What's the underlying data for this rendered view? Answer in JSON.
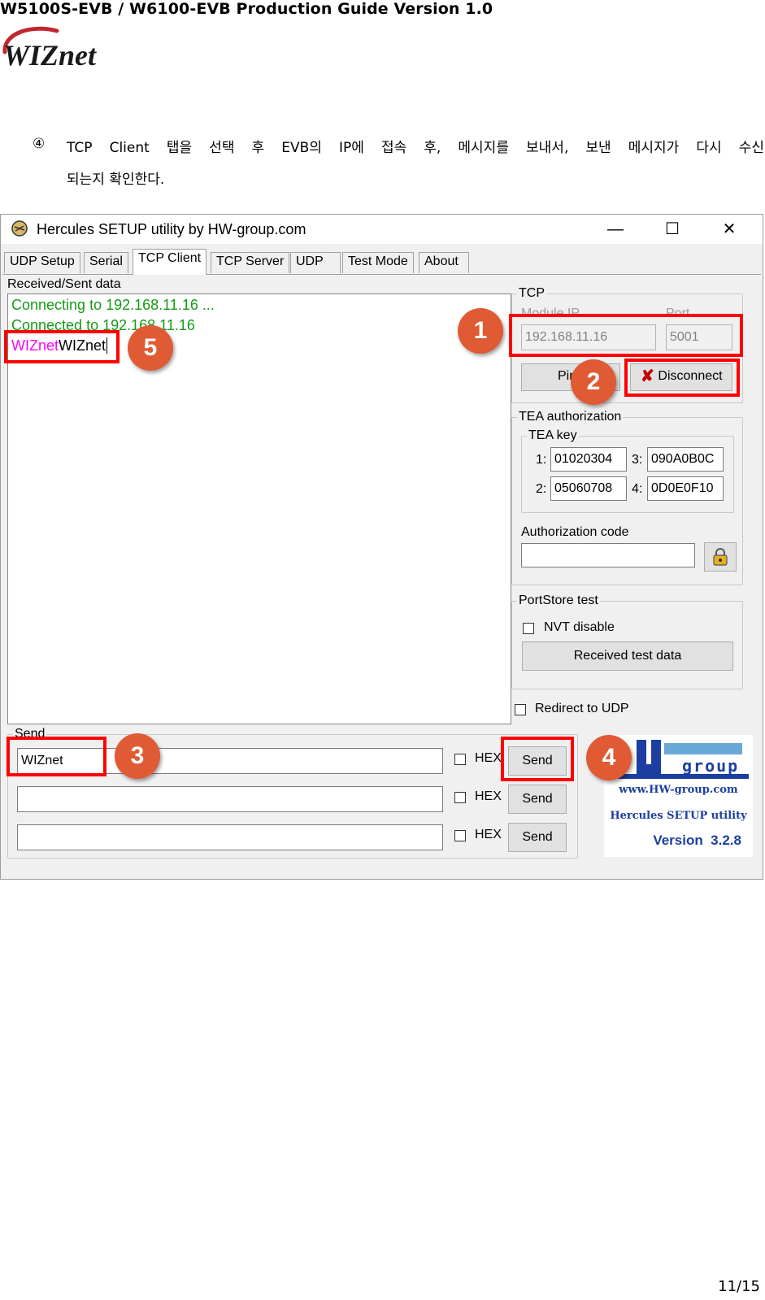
{
  "document": {
    "header": "W5100S-EVB / W6100-EVB Production Guide Version 1.0",
    "logo_text": "WIZnet",
    "step_number": "④",
    "step_text_line1": "TCP Client 탭을 선택 후 EVB의 IP에 접속 후, 메시지를 보내서, 보낸 메시지가 다시 수신",
    "step_text_line2": "되는지 확인한다.",
    "page_number": "11/15"
  },
  "window": {
    "title": "Hercules SETUP utility by HW-group.com",
    "controls": {
      "minimize": "—",
      "maximize": "☐",
      "close": "✕"
    },
    "tabs": [
      "UDP Setup",
      "Serial",
      "TCP Client",
      "TCP Server",
      "UDP",
      "Test Mode",
      "About"
    ],
    "active_tab": "TCP Client",
    "received": {
      "label": "Received/Sent data",
      "lines": [
        "Connecting to 192.168.11.16 ...",
        "Connected to 192.168.11.16"
      ],
      "echo_sent": "WIZnet",
      "echo_received": "WIZnet"
    },
    "tcp": {
      "legend": "TCP",
      "module_ip_label": "Module IP",
      "module_ip": "192.168.11.16",
      "port_label": "Port",
      "port": "5001",
      "ping_label": "Ping",
      "disconnect_label": "Disconnect"
    },
    "tea": {
      "legend": "TEA authorization",
      "key_legend": "TEA key",
      "keys": [
        {
          "label": "1:",
          "value": "01020304"
        },
        {
          "label": "3:",
          "value": "090A0B0C"
        },
        {
          "label": "2:",
          "value": "05060708"
        },
        {
          "label": "4:",
          "value": "0D0E0F10"
        }
      ],
      "auth_label": "Authorization code",
      "auth_value": ""
    },
    "portstore": {
      "legend": "PortStore test",
      "nvt_label": "NVT disable",
      "received_button": "Received test data"
    },
    "redirect_label": "Redirect to UDP",
    "send": {
      "legend": "Send",
      "rows": [
        {
          "value": "WIZnet",
          "hex_label": "HEX",
          "button": "Send"
        },
        {
          "value": "",
          "hex_label": "HEX",
          "button": "Send"
        },
        {
          "value": "",
          "hex_label": "HEX",
          "button": "Send"
        }
      ]
    },
    "hw_logo": {
      "brand": "group",
      "url": "www.HW-group.com",
      "product": "Hercules SETUP utility",
      "version": "Version  3.2.8"
    }
  },
  "annotations": [
    "1",
    "2",
    "3",
    "4",
    "5"
  ],
  "colors": {
    "annotation_red": "#ff0000",
    "badge": "#e05a34",
    "connect_green": "#169b16",
    "sent_magenta": "#ff00ff",
    "hw_blue": "#1b3ea0"
  }
}
